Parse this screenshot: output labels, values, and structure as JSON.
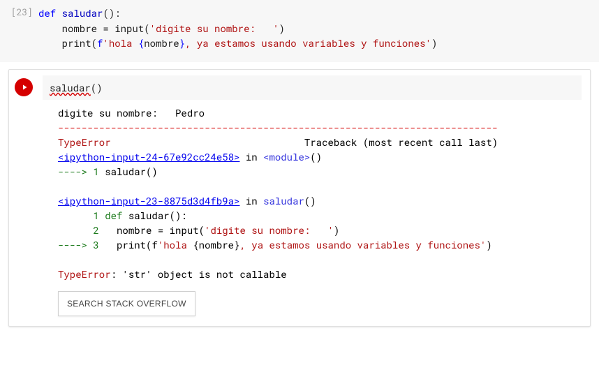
{
  "cell1": {
    "prompt": "[23]",
    "lines": {
      "def_kw": "def",
      "def_name": " saludar",
      "def_par": "():",
      "l2a": "    nombre ",
      "l2b": "=",
      "l2c": " input(",
      "l2str": "'digite su nombre:   '",
      "l2d": ")",
      "l3a": "    print(",
      "l3f": "f",
      "l3s1": "'hola ",
      "l3br1": "{",
      "l3var": "nombre",
      "l3br2": "}",
      "l3s2": ", ya estamos usando variables y funciones'",
      "l3d": ")"
    }
  },
  "cell2": {
    "input_call": "saludar",
    "input_par": "()",
    "output": {
      "prompt_line": "digite su nombre:   Pedro",
      "sep": "---------------------------------------------------------------------------",
      "err_name": "TypeError",
      "tb_text": "                                 Traceback (most recent call last)",
      "loc1": "<ipython-input-24-67e92cc24e58>",
      "in1": " in ",
      "mod1": "<module>",
      "par1": "()",
      "ptr1": "----> 1",
      "l1": " saludar()",
      "loc2": "<ipython-input-23-8875d3d4fb9a>",
      "in2": " in ",
      "mod2": "saludar",
      "par2": "()",
      "ln1": "      1",
      "ln1_def": " def",
      "ln1_rest": " saludar():",
      "ln2": "      2",
      "ln2a": "   nombre ",
      "ln2b": "=",
      "ln2c": " input(",
      "ln2str": "'digite su nombre:   '",
      "ln2d": ")",
      "ptr3": "----> 3",
      "ln3a": "   print(",
      "ln3f": "f",
      "ln3s1": "'hola ",
      "ln3br1": "{",
      "ln3var": "nombre",
      "ln3br2": "}",
      "ln3s2": ", ya estamos usando variables y funciones'",
      "ln3d": ")",
      "final_err": "TypeError",
      "final_msg": ": 'str' object is not callable",
      "so_button": "SEARCH STACK OVERFLOW"
    }
  }
}
